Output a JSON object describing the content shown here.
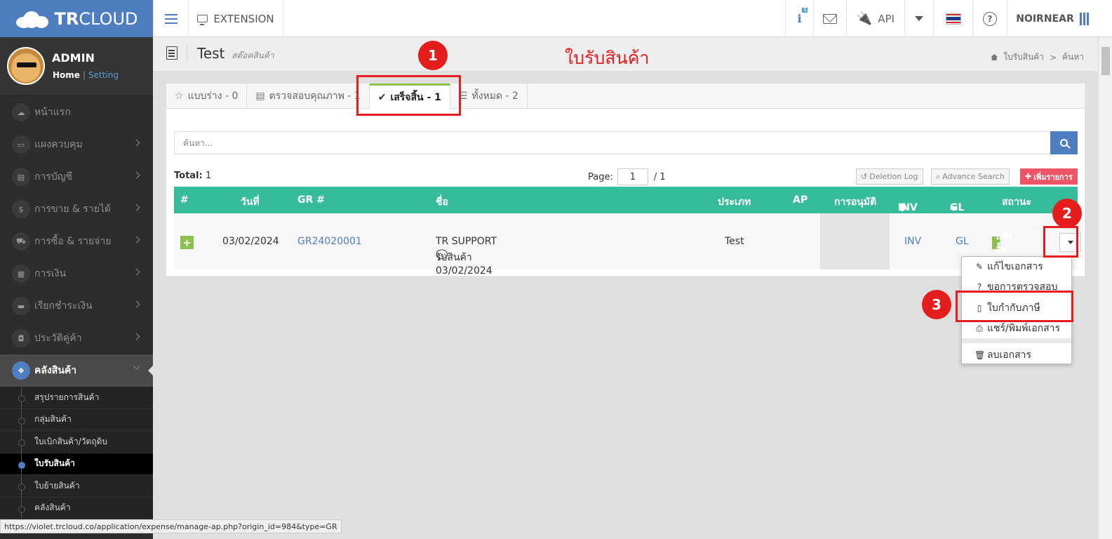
{
  "topbar": {
    "brand_bold": "TR",
    "brand_light": "CLOUD",
    "extension_label": "EXTENSION",
    "info_badge": "1",
    "api_label": "API",
    "username": "NOIRNEAR"
  },
  "user": {
    "name": "ADMIN",
    "home_link": "Home",
    "setting_link": "Setting"
  },
  "sidebar": {
    "items": [
      {
        "label": "หน้าแรก",
        "icon": "cloud-icon",
        "glyph": "☁"
      },
      {
        "label": "แผงควบคุม",
        "icon": "monitor-icon",
        "glyph": "▭"
      },
      {
        "label": "การบัญชี",
        "icon": "book-icon",
        "glyph": "▤"
      },
      {
        "label": "การขาย & รายได้",
        "icon": "dollar-icon",
        "glyph": "$"
      },
      {
        "label": "การซื้อ & รายจ่าย",
        "icon": "cart-icon",
        "glyph": "⛟"
      },
      {
        "label": "การเงิน",
        "icon": "calendar-icon",
        "glyph": "▦"
      },
      {
        "label": "เรียกชำระเงิน",
        "icon": "credit-card-icon",
        "glyph": "▬"
      },
      {
        "label": "ประวัติคู่ค้า",
        "icon": "address-book-icon",
        "glyph": "◘"
      },
      {
        "label": "คลังสินค้า",
        "icon": "cubes-icon",
        "glyph": "❖"
      }
    ],
    "sub_items": [
      {
        "label": "สรุปรายการสินค้า"
      },
      {
        "label": "กลุ่มสินค้า"
      },
      {
        "label": "ใบเบิกสินค้า/วัตถุดิบ"
      },
      {
        "label": "ใบรับสินค้า"
      },
      {
        "label": "ใบย้ายสินค้า"
      },
      {
        "label": "คลังสินค้า"
      }
    ]
  },
  "header": {
    "title": "Test",
    "subtitle": "สต๊อคสินค้า",
    "annotation_title": "ใบรับสินค้า",
    "breadcrumb": [
      "ใบรับสินค้า",
      "ค้นหา"
    ]
  },
  "tabs": [
    {
      "label": "แบบร่าง - 0",
      "icon": "star-icon",
      "glyph": "☆"
    },
    {
      "label": "ตรวจสอบคุณภาพ - 1",
      "icon": "document-icon",
      "glyph": "▤"
    },
    {
      "label": "เสร็จสิ้น - 1",
      "icon": "check-circle-icon",
      "glyph": "✔"
    },
    {
      "label": "ทั้งหมด - 2",
      "icon": "list-icon",
      "glyph": "☰"
    }
  ],
  "search": {
    "placeholder": "ค้นหา..."
  },
  "list": {
    "total_label": "Total:",
    "total_value": "1",
    "page_label": "Page:",
    "page_value": "1",
    "page_total": "/ 1",
    "deletion_log": "Deletion Log",
    "advance_search": "Advance Search",
    "add_item": "เพิ่มรายการ"
  },
  "table": {
    "columns": [
      "#",
      "วันที่",
      "GR #",
      "ชื่อ",
      "ประเภท",
      "AP",
      "การอนุมัติ",
      "INV",
      "GL",
      "สถานะ"
    ],
    "rows": [
      {
        "date": "03/02/2024",
        "gr_no": "GR24020001",
        "name": "TR SUPPORT",
        "note": "รับสินค้า 03/02/2024",
        "type": "Test",
        "inv": "INV",
        "gl": "GL",
        "status": "เสร็จสิ้น"
      }
    ]
  },
  "menu": {
    "items": [
      {
        "label": "แก้ไขเอกสาร",
        "glyph": "✎"
      },
      {
        "label": "ขอการตรวจสอบ",
        "glyph": "?"
      },
      {
        "label": "ใบกำกับภาษี",
        "glyph": "▯"
      },
      {
        "label": "แชร์/พิมพ์เอกสาร",
        "glyph": "⎙"
      },
      {
        "label": "ลบเอกสาร",
        "glyph": "🗑"
      }
    ]
  },
  "annotations": [
    "1",
    "2",
    "3"
  ],
  "statusbar": {
    "url": "https://violet.trcloud.co/application/expense/manage-ap.php?origin_id=984&type=GR"
  },
  "colors": {
    "brand": "#4f7ec0",
    "table_header": "#37bc9b",
    "success": "#8cc152",
    "danger": "#ed5565",
    "annotation": "#e61d1d"
  }
}
